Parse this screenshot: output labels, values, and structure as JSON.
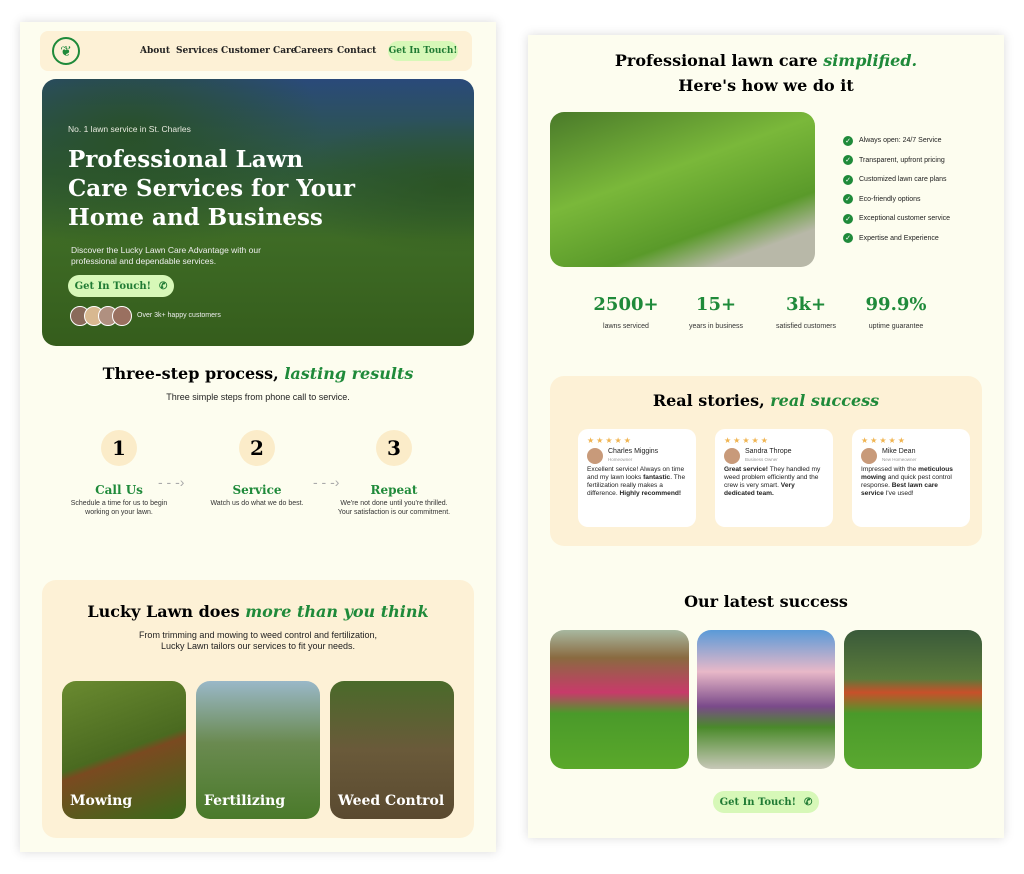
{
  "nav": {
    "links": [
      "About",
      "Services",
      "Customer Care",
      "Careers",
      "Contact"
    ],
    "cta": "Get In Touch!"
  },
  "hero": {
    "eyebrow": "No. 1 lawn service in St. Charles",
    "title_lines": [
      "Professional  Lawn",
      "Care Services for Your",
      "Home and Business"
    ],
    "subtitle_lines": [
      "Discover the Lucky Lawn Care Advantage with our",
      "professional and dependable services."
    ],
    "cta": "Get In Touch!",
    "social_proof": "Over 3k+ happy customers"
  },
  "process": {
    "title": "Three-step process, ",
    "title_accent": "lasting results",
    "subtitle": "Three simple steps from phone call to service.",
    "steps": [
      {
        "num": "1",
        "title": "Call Us",
        "desc": [
          "Schedule a time for us to begin",
          "working on your lawn."
        ]
      },
      {
        "num": "2",
        "title": "Service",
        "desc": [
          "Watch us do what we do best.",
          ""
        ]
      },
      {
        "num": "3",
        "title": "Repeat",
        "desc": [
          "We're not done until you're thrilled.",
          "Your satisfaction is our commitment."
        ]
      }
    ]
  },
  "services": {
    "title": "Lucky Lawn does ",
    "title_accent": "more than you think",
    "subtitle_lines": [
      "From trimming and mowing to weed control and fertilization,",
      "Lucky Lawn tailors our services to fit your needs."
    ],
    "cards": [
      "Mowing",
      "Fertilizing",
      "Weed Control"
    ]
  },
  "simplified": {
    "title": "Professional lawn care ",
    "title_accent": "simplified.",
    "title2": "Here's how we do it",
    "features": [
      "Always open: 24/7 Service",
      "Transparent, upfront pricing",
      "Customized lawn care plans",
      "Eco-friendly options",
      "Exceptional customer service",
      "Expertise and Experience"
    ],
    "stats": [
      {
        "value": "2500+",
        "label": "lawns serviced"
      },
      {
        "value": "15+",
        "label": "years in business"
      },
      {
        "value": "3k+",
        "label": "satisfied customers"
      },
      {
        "value": "99.9%",
        "label": "uptime guarantee"
      }
    ]
  },
  "reviews": {
    "title": "Real stories, ",
    "title_accent": "real success",
    "stars": "★★★★★",
    "items": [
      {
        "name": "Charles Miggins",
        "role": "Homeowner",
        "html": "Excellent service! Always on time and my lawn looks <b>fantastic</b>. The fertilization really makes a difference. <b>Highly recommend!</b>"
      },
      {
        "name": "Sandra Thrope",
        "role": "Business Owner",
        "html": "<b>Great service!</b> They handled my weed problem efficiently and the crew is very smart. <b>Very dedicated team.</b>"
      },
      {
        "name": "Mike Dean",
        "role": "New Homeowner",
        "html": "Impressed with the <b>meticulous mowing</b> and quick pest control response. <b>Best lawn care service</b> I've used!"
      }
    ]
  },
  "gallery": {
    "title": "Our latest success",
    "cta": "Get In Touch!"
  },
  "colors": {
    "accent": "#1f8a3a",
    "cta_bg": "#d7f8b8",
    "panel_bg": "#fdfdef",
    "section_bg": "#fdf1d6"
  }
}
